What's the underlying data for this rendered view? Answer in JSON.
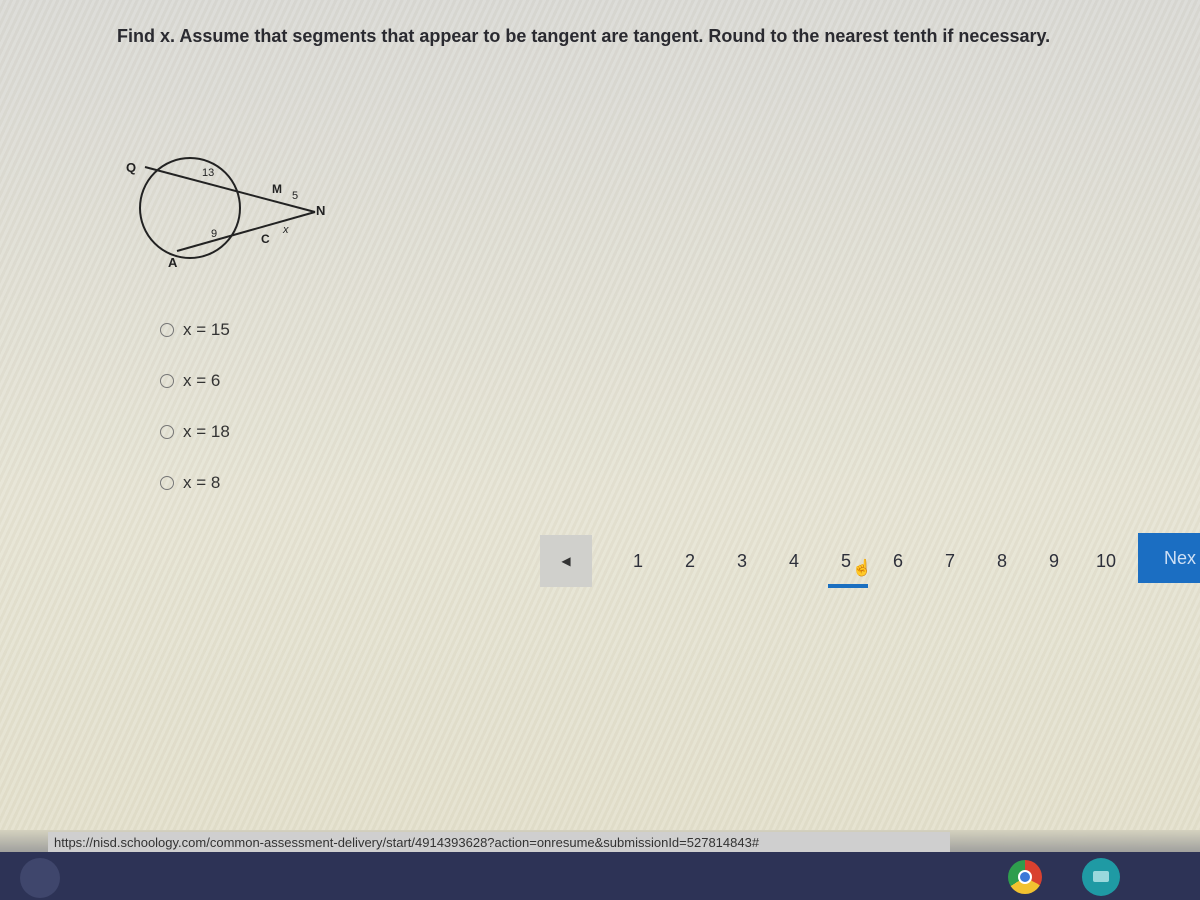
{
  "question": {
    "prompt": "Find x. Assume that segments that appear to be tangent are tangent. Round to the nearest tenth if necessary."
  },
  "figure": {
    "labels": {
      "Q": "Q",
      "M": "M",
      "N": "N",
      "C": "C",
      "A": "A",
      "seg_QM": "13",
      "seg_MN": "5",
      "seg_AC": "9",
      "seg_CN": "x"
    }
  },
  "options": [
    {
      "label": "x = 15",
      "selected": false
    },
    {
      "label": "x = 6",
      "selected": false
    },
    {
      "label": "x = 18",
      "selected": false
    },
    {
      "label": "x = 8",
      "selected": false
    }
  ],
  "pagination": {
    "prev_icon": "left-triangle",
    "pages": [
      "1",
      "2",
      "3",
      "4",
      "5",
      "6",
      "7",
      "8",
      "9",
      "10"
    ],
    "current_page": "5",
    "next_label": "Nex"
  },
  "statusbar": {
    "url": "https://nisd.schoology.com/common-assessment-delivery/start/4914393628?action=onresume&submissionId=527814843#"
  },
  "taskbar": {
    "apps": [
      "launcher",
      "chrome",
      "meet"
    ]
  }
}
